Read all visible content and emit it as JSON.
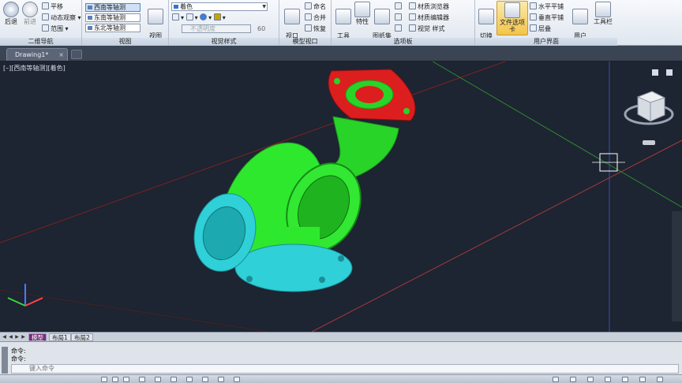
{
  "ribbon": {
    "undo_label": "后退",
    "redo_label": "前进",
    "pan_label": "平移",
    "orbit_label": "动态观察",
    "extents_label": "范围",
    "nav_panel_title": "二维导航",
    "views": [
      "西南等轴测",
      "东南等轴测",
      "东北等轴测"
    ],
    "view_manager_label": "视图\n管理器",
    "view_panel_title": "视图",
    "visual_style_value": "着色",
    "visual_style_placeholder": "不透明度",
    "opacity_value": "60",
    "visual_panel_title": "视觉样式",
    "viewport_config_label": "视口\n配置",
    "named_label": "命名",
    "join_label": "合并",
    "restore_label": "恢复",
    "model_viewport_title": "模型视口",
    "tool_palette_label": "工具\n选项板",
    "properties_label": "特性",
    "sheetset_label": "图纸集\n管理器",
    "material_browser_label": "材质浏览器",
    "material_editor_label": "材质编辑器",
    "visual_styles_label": "视觉 样式",
    "palettes_title": "选项板",
    "switch_window_label": "切换\n窗口",
    "file_tabs_label": "文件选项卡",
    "tile_h_label": "水平平铺",
    "tile_v_label": "垂直平铺",
    "cascade_label": "层叠",
    "user_interface_label": "用户\n界面",
    "toolbars_label": "工具栏",
    "ui_title": "用户界面"
  },
  "tabs": {
    "document": "Drawing1*"
  },
  "viewport": {
    "label": "[–][西南等轴测][着色]"
  },
  "layout_tabs": [
    "模型",
    "布局1",
    "布局2"
  ],
  "command": {
    "line1": "命令:",
    "line2": "命令:",
    "placeholder": "键入命令"
  },
  "colors": {
    "body": "#2ee82e",
    "flange_top": "#dd1e1e",
    "cyan_part": "#2fd0d8",
    "background": "#1d2432"
  }
}
